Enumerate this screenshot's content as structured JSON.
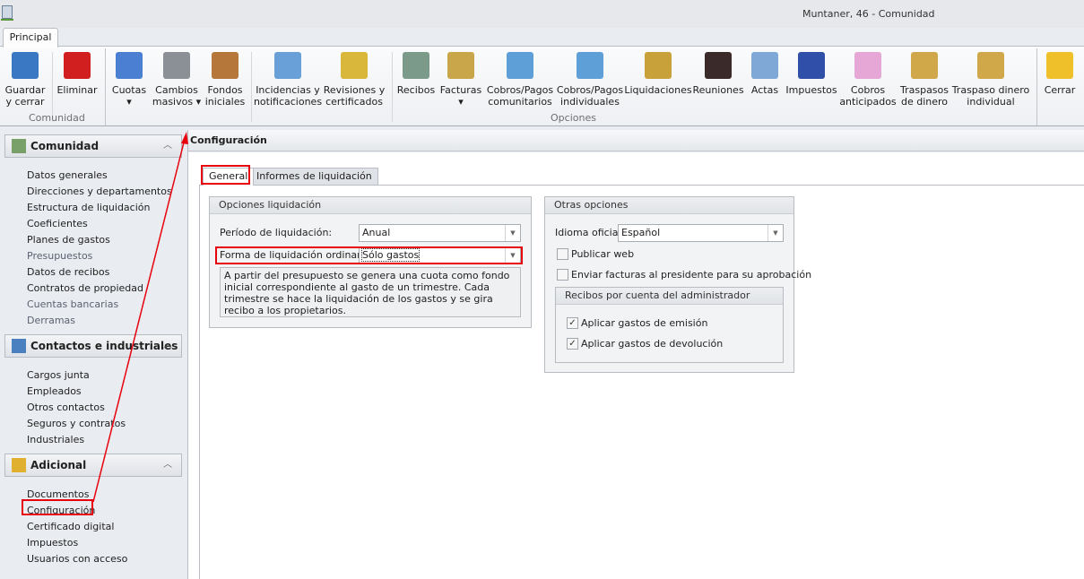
{
  "window": {
    "title": "Muntaner, 46 - Comunidad"
  },
  "ribbon": {
    "tab": "Principal",
    "groups": {
      "comunidad": "Comunidad",
      "opciones": "Opciones"
    },
    "buttons": [
      {
        "l1": "Guardar",
        "l2": "y cerrar",
        "icon": "floppy-save-icon"
      },
      {
        "l1": "Eliminar",
        "l2": "",
        "icon": "red-x-delete-icon"
      },
      {
        "l1": "Cuotas",
        "l2": "▾",
        "icon": "calendar-coins-icon"
      },
      {
        "l1": "Cambios",
        "l2": "masivos ▾",
        "icon": "gear-icon"
      },
      {
        "l1": "Fondos",
        "l2": "iniciales",
        "icon": "scales-icon"
      },
      {
        "l1": "Incidencias y",
        "l2": "notificaciones",
        "icon": "clipboard-check-icon"
      },
      {
        "l1": "Revisiones y",
        "l2": "certificados",
        "icon": "notebook-bell-icon"
      },
      {
        "l1": "Recibos",
        "l2": "",
        "icon": "receipt-icon"
      },
      {
        "l1": "Facturas",
        "l2": "▾",
        "icon": "invoice-coins-icon"
      },
      {
        "l1": "Cobros/Pagos",
        "l2": "comunitarios",
        "icon": "calculator-icon"
      },
      {
        "l1": "Cobros/Pagos",
        "l2": "individuales",
        "icon": "calculator-person-icon"
      },
      {
        "l1": "Liquidaciones",
        "l2": "",
        "icon": "document-seal-icon"
      },
      {
        "l1": "Reuniones",
        "l2": "",
        "icon": "meeting-people-icon"
      },
      {
        "l1": "Actas",
        "l2": "",
        "icon": "certificate-ribbon-icon"
      },
      {
        "l1": "Impuestos",
        "l2": "",
        "icon": "tax-agency-icon"
      },
      {
        "l1": "Cobros",
        "l2": "anticipados",
        "icon": "piggy-bank-icon"
      },
      {
        "l1": "Traspasos",
        "l2": "de dinero",
        "icon": "money-transfer-icon"
      },
      {
        "l1": "Traspaso dinero",
        "l2": "individual",
        "icon": "money-transfer-person-icon"
      },
      {
        "l1": "Cerrar",
        "l2": "",
        "icon": "folder-close-icon"
      }
    ]
  },
  "sidebar": {
    "sections": [
      {
        "title": "Comunidad",
        "icon": "building-icon",
        "items": [
          "Datos generales",
          "Direcciones y departamentos",
          "Estructura de liquidación",
          "Coeficientes",
          "Planes de gastos",
          "Presupuestos",
          "Datos de recibos",
          "Contratos de propiedad",
          "Cuentas bancarias",
          "Derramas"
        ]
      },
      {
        "title": "Contactos e industriales",
        "icon": "people-icon",
        "items": [
          "Cargos junta",
          "Empleados",
          "Otros contactos",
          "Seguros y contratos",
          "Industriales"
        ]
      },
      {
        "title": "Adicional",
        "icon": "database-icon",
        "items": [
          "Documentos",
          "Configuración",
          "Certificado digital",
          "Impuestos",
          "Usuarios con acceso"
        ]
      }
    ]
  },
  "content": {
    "title": "Configuración",
    "tabs": [
      "General",
      "Informes de liquidación"
    ],
    "opciones_liquidacion": {
      "title": "Opciones liquidación",
      "periodo_label": "Período de liquidación:",
      "periodo_value": "Anual",
      "forma_label": "Forma de liquidación ordinaria:",
      "forma_value": "Sólo gastos",
      "description": "A partir del presupuesto se genera una cuota como fondo inicial correspondiente al gasto de un trimestre. Cada trimestre se hace la liquidación de los gastos y se gira recibo a los propietarios."
    },
    "otras_opciones": {
      "title": "Otras opciones",
      "idioma_label": "Idioma oficial:",
      "idioma_value": "Español",
      "publicar_web": {
        "label": "Publicar web",
        "checked": false
      },
      "enviar_facturas": {
        "label": "Enviar facturas al presidente para su aprobación",
        "checked": false
      },
      "recibos": {
        "title": "Recibos por cuenta del administrador",
        "emision": {
          "label": "Aplicar gastos de emisión",
          "checked": true
        },
        "devolucion": {
          "label": "Aplicar gastos de devolución",
          "checked": true
        }
      }
    }
  },
  "colors": {
    "annotation": "#e8000d"
  }
}
